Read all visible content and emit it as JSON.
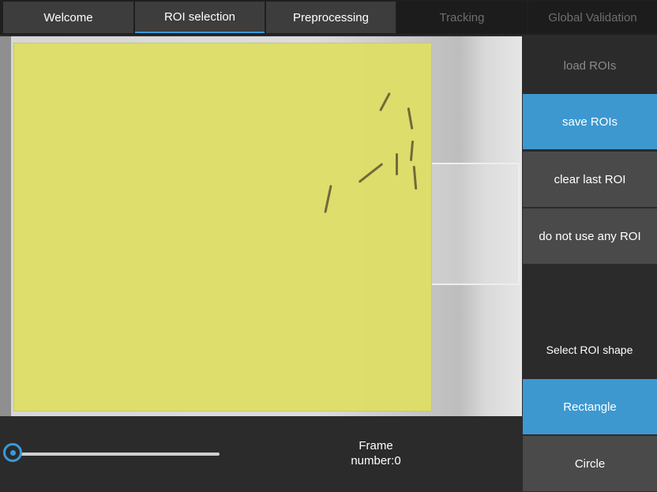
{
  "tabs": [
    {
      "label": "Welcome",
      "state": "normal"
    },
    {
      "label": "ROI selection",
      "state": "active"
    },
    {
      "label": "Preprocessing",
      "state": "normal"
    },
    {
      "label": "Tracking",
      "state": "disabled"
    },
    {
      "label": "Global Validation",
      "state": "disabled"
    }
  ],
  "side_panel": {
    "load_rois": "load ROIs",
    "save_rois": "save ROIs",
    "clear_last_roi": "clear last ROI",
    "do_not_use_any_roi": "do not use any ROI",
    "shape_label": "Select ROI shape",
    "shape_rectangle": "Rectangle",
    "shape_circle": "Circle"
  },
  "frame": {
    "label": "Frame\nnumber:0",
    "slider_value": 0
  },
  "colors": {
    "accent": "#3a9ad9",
    "roi_fill": "#dede68",
    "button_gray": "#4a4a4a",
    "background": "#2b2b2b"
  }
}
